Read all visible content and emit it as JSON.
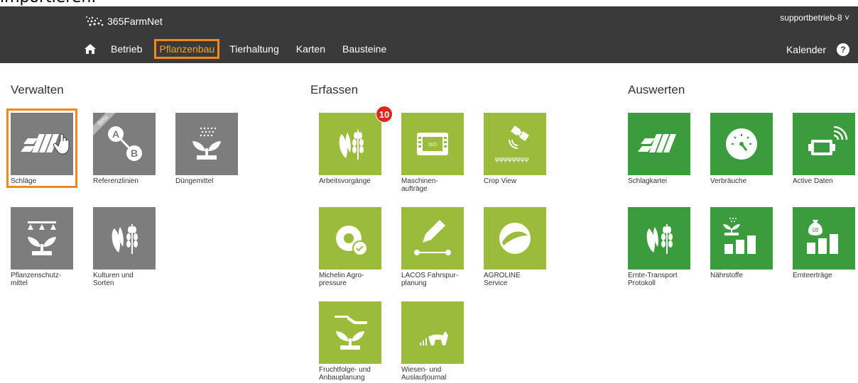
{
  "clipped_caption": "importieren.",
  "header": {
    "logo_text": "365FarmNet",
    "user_menu": "supportbetrieb-8 ˅",
    "nav_items": [
      "Betrieb",
      "Pflanzenbau",
      "Tierhaltung",
      "Karten",
      "Bausteine"
    ],
    "active_nav": "Pflanzenbau",
    "calendar": "Kalender",
    "help": "?"
  },
  "sections": {
    "verwalten": {
      "title": "Verwalten",
      "tiles": [
        {
          "label": "Schläge",
          "icon": "fields-icon"
        },
        {
          "label": "Referenzlinien",
          "icon": "reference-line-icon",
          "badge": "Beta"
        },
        {
          "label": "Düngemittel",
          "icon": "fertilizer-icon"
        },
        {
          "label": "Pflanzenschutz-\nmittel",
          "icon": "crop-protection-icon"
        },
        {
          "label": "Kulturen und\nSorten",
          "icon": "crops-icon"
        }
      ]
    },
    "erfassen": {
      "title": "Erfassen",
      "tiles": [
        {
          "label": "Arbeitsvorgänge",
          "icon": "work-processes-icon",
          "count": "10"
        },
        {
          "label": "Maschinen-\naufträge",
          "icon": "iso-terminal-icon"
        },
        {
          "label": "Crop View",
          "icon": "satellite-icon"
        },
        {
          "label": "Michelin Agro-\npressure",
          "icon": "tire-pressure-icon"
        },
        {
          "label": "LACOS Fahrspur-\nplanung",
          "icon": "track-planning-icon"
        },
        {
          "label": "AGROLINE\nService",
          "icon": "agroline-icon"
        },
        {
          "label": "Fruchtfolge- und\nAnbauplanung",
          "icon": "crop-rotation-icon"
        },
        {
          "label": "Wiesen- und\nAuslaufjournal",
          "icon": "pasture-journal-icon"
        }
      ]
    },
    "auswerten": {
      "title": "Auswerten",
      "tiles": [
        {
          "label": "Schlagkartei",
          "icon": "field-records-icon"
        },
        {
          "label": "Verbräuche",
          "icon": "gauge-icon"
        },
        {
          "label": "Active Daten",
          "icon": "telemetry-icon"
        },
        {
          "label": "Ernte-Transport\nProtokoll",
          "icon": "harvest-transport-icon"
        },
        {
          "label": "Nährstoffe",
          "icon": "nutrients-icon"
        },
        {
          "label": "Ernteerträge",
          "icon": "yields-icon"
        }
      ]
    }
  },
  "colors": {
    "header_bg": "#3a3a3a",
    "highlight": "#f08a1c",
    "manage_tile": "#7d7d7d",
    "record_tile": "#9bbb3b",
    "evaluate_tile": "#3a9c3d",
    "badge": "#e1251b"
  }
}
